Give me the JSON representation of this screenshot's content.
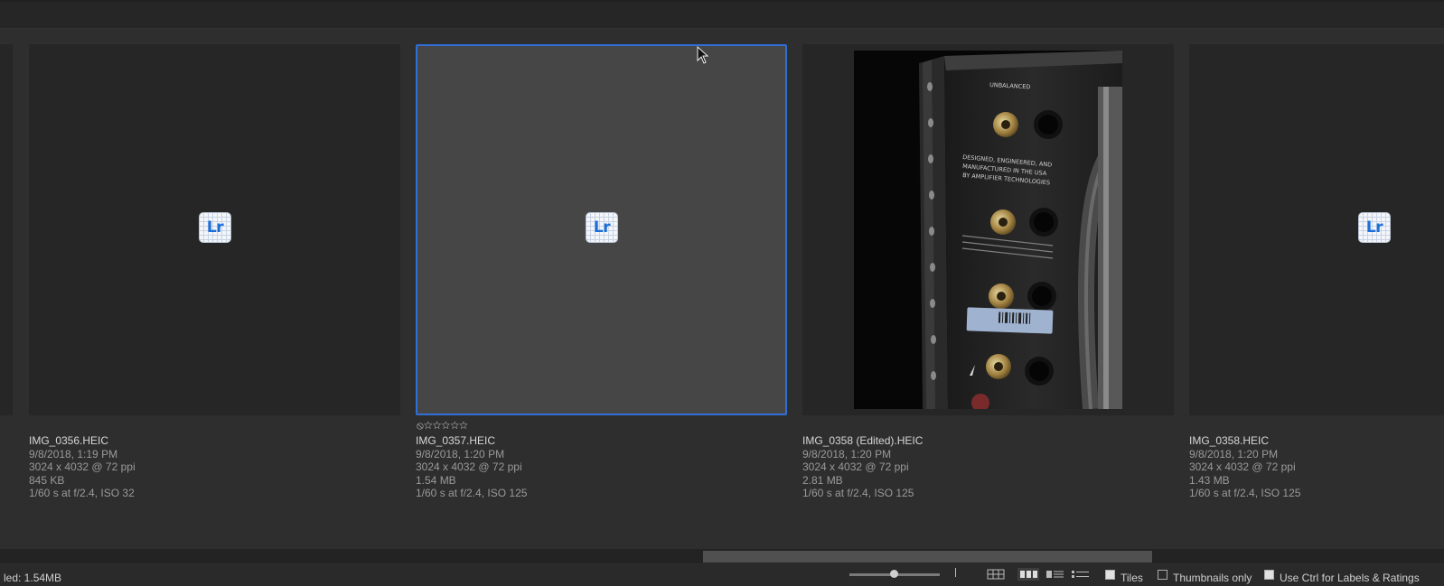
{
  "thumbnails": [
    {
      "filename": "IMG_0356.HEIC",
      "datetime": "9/8/2018, 1:19 PM",
      "dimensions": "3024 x 4032 @ 72 ppi",
      "size": "845 KB",
      "exposure": "1/60 s at f/2.4, ISO 32",
      "icon_text": "Lr"
    },
    {
      "filename": "IMG_0357.HEIC",
      "datetime": "9/8/2018, 1:20 PM",
      "dimensions": "3024 x 4032 @ 72 ppi",
      "size": "1.54 MB",
      "exposure": "1/60 s at f/2.4, ISO 125",
      "icon_text": "Lr",
      "rating_glyphs": "⦸☆☆☆☆☆"
    },
    {
      "filename": "IMG_0358 (Edited).HEIC",
      "datetime": "9/8/2018, 1:20 PM",
      "dimensions": "3024 x 4032 @ 72 ppi",
      "size": "2.81 MB",
      "exposure": "1/60 s at f/2.4, ISO 125"
    },
    {
      "filename": "IMG_0358.HEIC",
      "datetime": "9/8/2018, 1:20 PM",
      "dimensions": "3024 x 4032 @ 72 ppi",
      "size": "1.43 MB",
      "exposure": "1/60 s at f/2.4, ISO 125",
      "icon_text": "Lr"
    }
  ],
  "photo_text": {
    "line1": "UNBALANCED",
    "line2": "DESIGNED, ENGINEERED, AND",
    "line3": "MANUFACTURED IN THE USA",
    "line4": "BY AMPLIFIER TECHNOLOGIES"
  },
  "status_bar": {
    "status_text": "led: 1.54MB",
    "tiles_label": "Tiles",
    "thumbnails_only_label": "Thumbnails only",
    "use_ctrl_label": "Use Ctrl for Labels & Ratings"
  },
  "colors": {
    "selection_border": "#2f6fd6",
    "lr_icon_blue": "#1c6fd8"
  }
}
